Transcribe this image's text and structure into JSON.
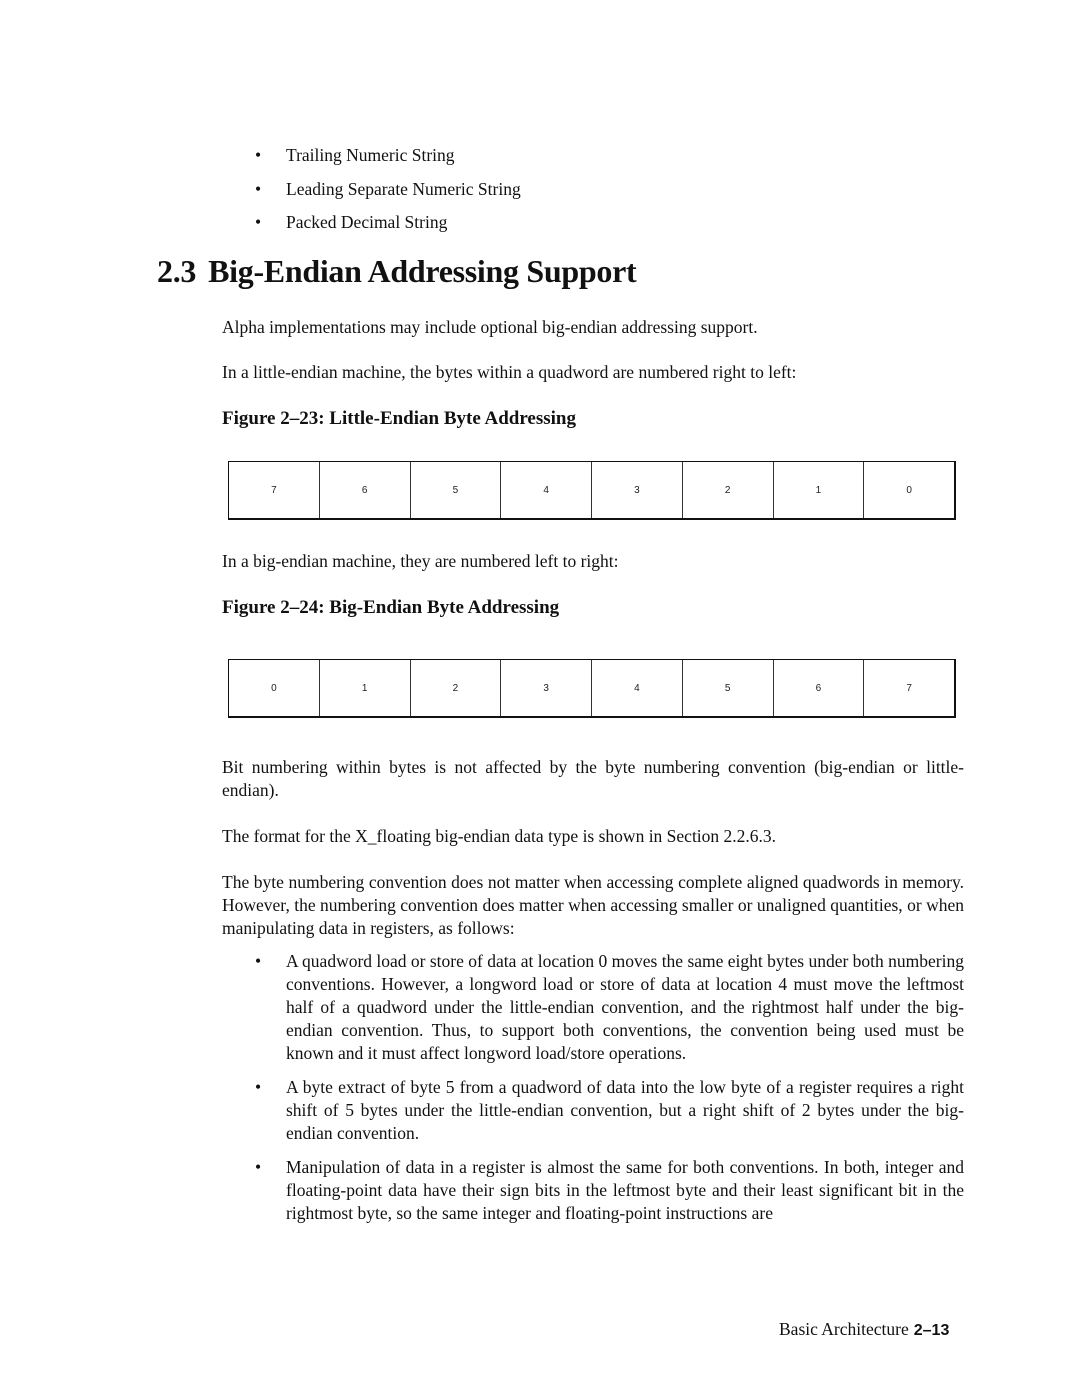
{
  "top_bullets": [
    "Trailing Numeric String",
    "Leading Separate Numeric String",
    "Packed Decimal String"
  ],
  "bullet_glyph": "•",
  "section": {
    "number": "2.3",
    "title": "Big-Endian Addressing Support"
  },
  "paragraphs": {
    "intro": "Alpha implementations may include optional big-endian addressing support.",
    "little_intro": "In a little-endian machine, the bytes within a quadword are numbered right to left:",
    "big_intro": "In a big-endian machine, they are numbered left to right:",
    "bit_numbering": "Bit numbering within bytes is not affected by the byte numbering convention (big-endian or little-endian).",
    "xfloating": "The format for the X_floating big-endian data type is shown in Section 2.2.6.3.",
    "convention": "The byte numbering convention does not matter when accessing complete aligned quadwords in memory. However, the numbering convention does matter when accessing smaller or unaligned quantities, or when manipulating data in registers, as follows:"
  },
  "figures": {
    "little": {
      "title": "Figure 2–23:  Little-Endian Byte Addressing",
      "bytes": [
        "7",
        "6",
        "5",
        "4",
        "3",
        "2",
        "1",
        "0"
      ]
    },
    "big": {
      "title": "Figure 2–24:  Big-Endian Byte Addressing",
      "bytes": [
        "0",
        "1",
        "2",
        "3",
        "4",
        "5",
        "6",
        "7"
      ]
    }
  },
  "detail_bullets": [
    "A quadword load or store of data at location 0 moves the same eight bytes under both numbering conventions. However, a longword load or store of data at location 4 must move the leftmost half of a quadword under the little-endian convention, and the rightmost half under the big-endian convention. Thus, to support both conventions, the convention being used must be known and it must affect longword load/store operations.",
    "A byte extract of byte 5 from a quadword of data into the low byte of a register requires a right shift of 5 bytes under the little-endian convention, but a right shift of 2 bytes under the big-endian convention.",
    "Manipulation of data in a register is almost the same for both conventions. In both, integer and floating-point data have their sign bits in the leftmost byte and their least significant bit in the rightmost byte, so the same integer and floating-point instructions are"
  ],
  "footer": {
    "chapter": "Basic Architecture",
    "page": "2–13"
  }
}
